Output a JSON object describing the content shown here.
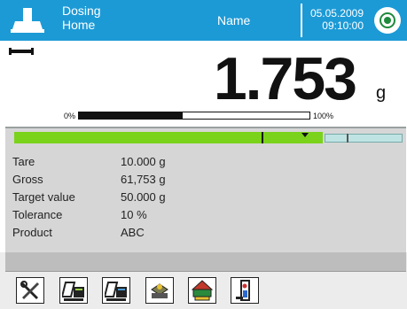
{
  "header": {
    "mode_line1": "Dosing",
    "mode_line2": "Home",
    "user": "Name",
    "date": "05.05.2009",
    "time": "09:10:00",
    "color": "#1c9ad6"
  },
  "weighing": {
    "value": "1.753",
    "unit": "g",
    "progress_min": "0%",
    "progress_max": "100%",
    "progress_fraction": 0.45
  },
  "info": {
    "tolerance_indicator": {
      "fill_fraction": 0.79,
      "fill_color": "#7bd21a"
    },
    "rows": [
      {
        "label": "Tare",
        "value": "10.000  g"
      },
      {
        "label": "Gross",
        "value": "61,753  g"
      },
      {
        "label": "Target value",
        "value": "50.000  g"
      },
      {
        "label": "Tolerance",
        "value": "10 %"
      },
      {
        "label": "Product",
        "value": "ABC"
      }
    ]
  },
  "footer": {
    "buttons": [
      {
        "icon": "tools-icon"
      },
      {
        "icon": "tare-database-icon"
      },
      {
        "icon": "product-database-icon"
      },
      {
        "icon": "weighing-pan-icon"
      },
      {
        "icon": "cdb-database-icon"
      },
      {
        "icon": "dosing-report-icon"
      }
    ]
  }
}
